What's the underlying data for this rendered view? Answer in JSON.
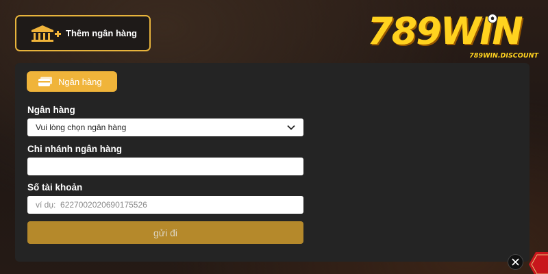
{
  "header": {
    "add_bank_label": "Thêm ngân hàng",
    "add_bank_icon": "bank-add-icon"
  },
  "logo": {
    "brand": "789WIN",
    "domain": "789WIN.DISCOUNT"
  },
  "form": {
    "tab_label": "Ngân hàng",
    "tab_icon": "card-icon",
    "bank_label": "Ngân hàng",
    "bank_select_value": "Vui lòng chọn ngân hàng",
    "branch_label": "Chi nhánh ngân hàng",
    "branch_value": "",
    "account_label": "Số tài khoản",
    "account_placeholder": "ví dụ:  6227002020690175526",
    "submit_label": "gửi đi"
  },
  "colors": {
    "accent": "#f0b43a",
    "submit": "#b5892b",
    "panel": "#242424"
  }
}
